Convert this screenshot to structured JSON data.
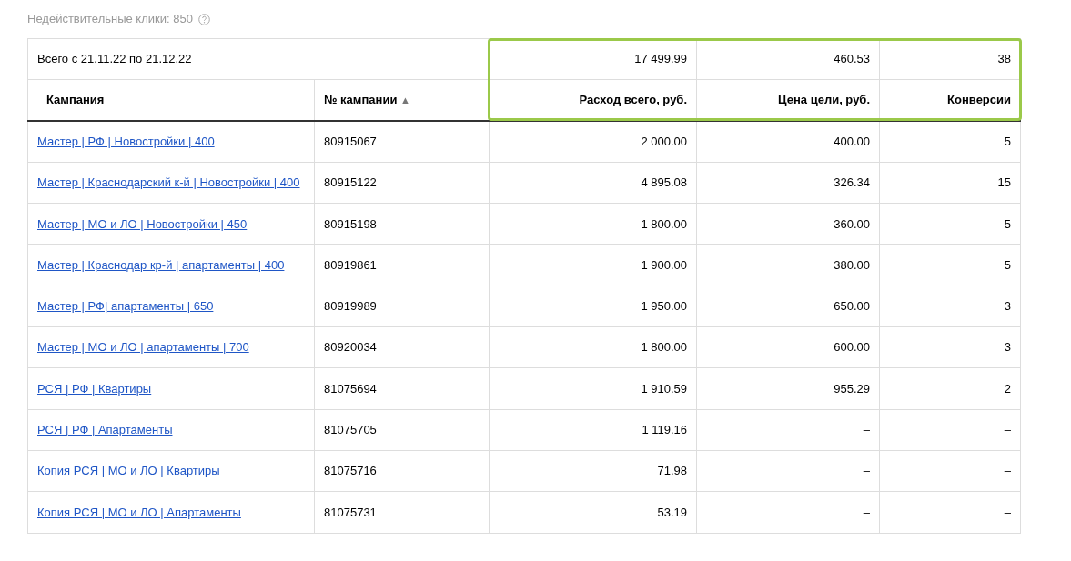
{
  "invalid_clicks": "Недействительные клики: 850",
  "table": {
    "total_label": "Всего с 21.11.22 по 21.12.22",
    "totals": [
      "17 499.99",
      "460.53",
      "38"
    ],
    "highlighted": true,
    "columns": [
      {
        "label": "Кампания"
      },
      {
        "label": "№ кампании",
        "sort_mark": "▲"
      },
      {
        "label": "Расход всего, руб."
      },
      {
        "label": "Цена цели, руб."
      },
      {
        "label": "Конверсии"
      }
    ],
    "rows": [
      {
        "campaign": "Мастер | РФ | Новостройки | 400",
        "number": "80915067",
        "spend": "2 000.00",
        "goal_price": "400.00",
        "conversions": "5"
      },
      {
        "campaign": "Мастер | Краснодарский к-й | Новостройки | 400",
        "number": "80915122",
        "spend": "4 895.08",
        "goal_price": "326.34",
        "conversions": "15"
      },
      {
        "campaign": "Мастер | МО и ЛО | Новостройки | 450",
        "number": "80915198",
        "spend": "1 800.00",
        "goal_price": "360.00",
        "conversions": "5"
      },
      {
        "campaign": "Мастер | Краснодар кр-й | апартаменты | 400",
        "number": "80919861",
        "spend": "1 900.00",
        "goal_price": "380.00",
        "conversions": "5"
      },
      {
        "campaign": "Мастер | РФ| апартаменты | 650",
        "number": "80919989",
        "spend": "1 950.00",
        "goal_price": "650.00",
        "conversions": "3"
      },
      {
        "campaign": "Мастер | МО и ЛО | апартаменты | 700",
        "number": "80920034",
        "spend": "1 800.00",
        "goal_price": "600.00",
        "conversions": "3"
      },
      {
        "campaign": "РСЯ | РФ | Квартиры",
        "number": "81075694",
        "spend": "1 910.59",
        "goal_price": "955.29",
        "conversions": "2"
      },
      {
        "campaign": "РСЯ | РФ | Апартаменты",
        "number": "81075705",
        "spend": "1 119.16",
        "goal_price": "–",
        "conversions": "–"
      },
      {
        "campaign": "Копия РСЯ | МО и ЛО | Квартиры",
        "number": "81075716",
        "spend": "71.98",
        "goal_price": "–",
        "conversions": "–"
      },
      {
        "campaign": "Копия РСЯ | МО и ЛО | Апартаменты",
        "number": "81075731",
        "spend": "53.19",
        "goal_price": "–",
        "conversions": "–"
      }
    ]
  }
}
